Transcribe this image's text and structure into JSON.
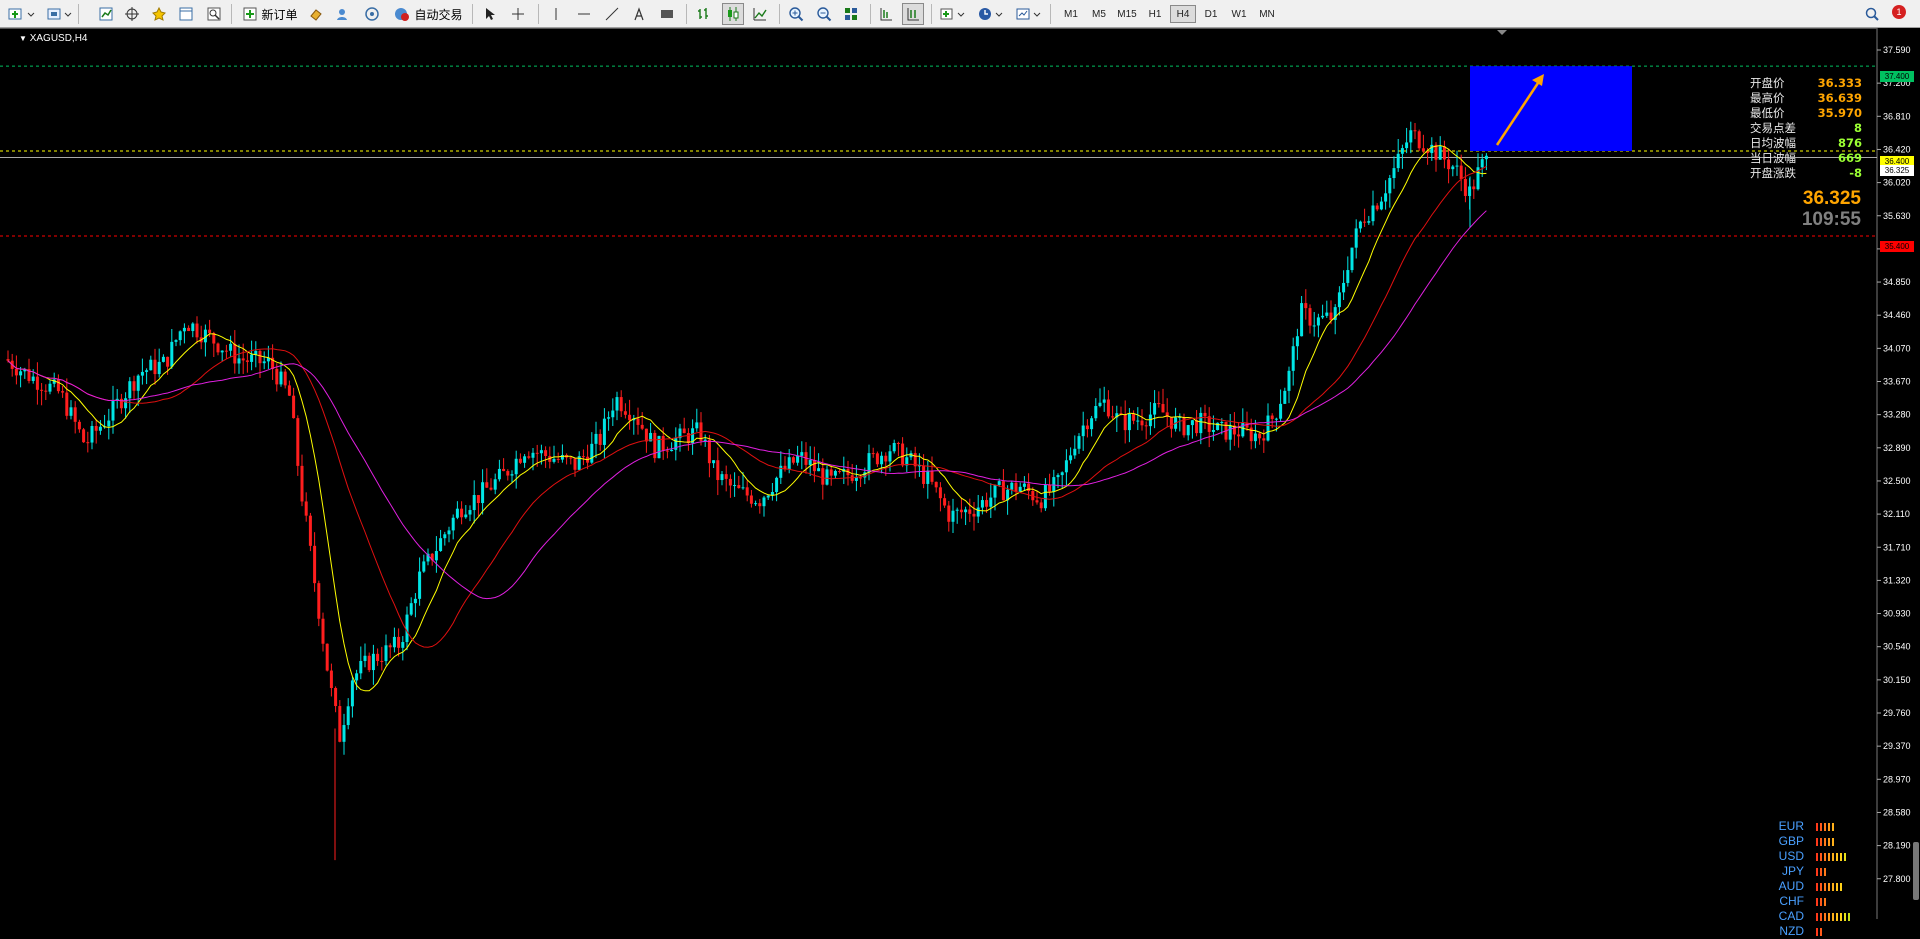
{
  "toolbar": {
    "new_order_label": "新订单",
    "auto_trade_label": "自动交易",
    "timeframes": [
      "M1",
      "M5",
      "M15",
      "H1",
      "H4",
      "D1",
      "W1",
      "MN"
    ],
    "active_timeframe": "H4",
    "notification_count": "1"
  },
  "chart": {
    "symbol_label": "XAGUSD,H4",
    "current_price": "36.325",
    "countdown": "109:55",
    "stats": [
      {
        "label": "开盘价",
        "value": "36.333"
      },
      {
        "label": "最高价",
        "value": "36.639"
      },
      {
        "label": "最低价",
        "value": "35.970"
      },
      {
        "label": "交易点差",
        "value": "8"
      },
      {
        "label": "日均波幅",
        "value": "876"
      },
      {
        "label": "当日波幅",
        "value": "669"
      },
      {
        "label": "开盘涨跌",
        "value": "-8"
      }
    ],
    "price_ticks": [
      "37.590",
      "37.200",
      "36.810",
      "36.420",
      "36.020",
      "35.630",
      "35.240",
      "34.850",
      "34.460",
      "34.070",
      "33.670",
      "33.280",
      "32.890",
      "32.500",
      "32.110",
      "31.710",
      "31.320",
      "30.930",
      "30.540",
      "30.150",
      "29.760",
      "29.370",
      "28.970",
      "28.580",
      "28.190",
      "27.800"
    ],
    "level_tags": {
      "target": "37.400",
      "entry": "36.400",
      "bid": "36.325",
      "stop": "35.400"
    },
    "colors": {
      "background": "#000000",
      "bull_candle": "#00e5e5",
      "bear_candle": "#ff1e1e",
      "ma_fast": "#ffff00",
      "ma_mid": "#e01010",
      "ma_slow": "#e020e0",
      "target_box": "#0000ff",
      "arrow": "#ffa500",
      "target_line": "#00c060",
      "entry_line": "#ffff00",
      "stop_line": "#ff0000"
    }
  },
  "currency_strength": [
    {
      "name": "EUR",
      "bars": 5
    },
    {
      "name": "GBP",
      "bars": 5
    },
    {
      "name": "USD",
      "bars": 8
    },
    {
      "name": "JPY",
      "bars": 3
    },
    {
      "name": "AUD",
      "bars": 7
    },
    {
      "name": "CHF",
      "bars": 3
    },
    {
      "name": "CAD",
      "bars": 9
    },
    {
      "name": "NZD",
      "bars": 2
    }
  ]
}
